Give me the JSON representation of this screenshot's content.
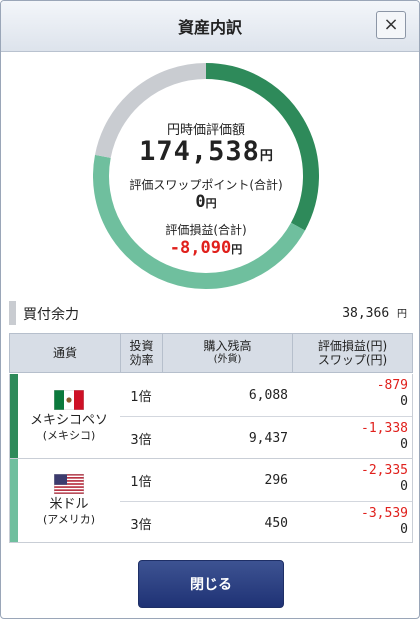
{
  "dialog": {
    "title": "資産内訳",
    "close_icon": "×",
    "close_button_label": "閉じる"
  },
  "summary": {
    "valuation_label": "円時価評価額",
    "valuation_value": "174,538",
    "swap_label": "評価スワップポイント(合計)",
    "swap_value": "0",
    "pl_label": "評価損益(合計)",
    "pl_value": "-8,090",
    "unit": "円"
  },
  "donut": {
    "segments": [
      {
        "name": "メキシコペソ",
        "fraction": 0.33,
        "color": "#2e8a5a"
      },
      {
        "name": "米ドル",
        "fraction": 0.45,
        "color": "#6fbf9e"
      },
      {
        "name": "買付余力",
        "fraction": 0.22,
        "color": "#c9ccd1"
      }
    ]
  },
  "buying_power": {
    "label": "買付余力",
    "value": "38,366",
    "unit": "円"
  },
  "table": {
    "headers": {
      "currency": "通貨",
      "leverage_1": "投資",
      "leverage_2": "効率",
      "balance_1": "購入残高",
      "balance_2": "(外貨)",
      "pl_1": "評価損益(円)",
      "pl_2": "スワップ(円)"
    },
    "groups": [
      {
        "currency": "メキシコペソ",
        "country": "(メキシコ)",
        "flag": "mexico-flag-icon",
        "color": "#2e8a5a",
        "rows": [
          {
            "leverage": "1倍",
            "balance": "6,088",
            "pl": "-879",
            "swap": "0"
          },
          {
            "leverage": "3倍",
            "balance": "9,437",
            "pl": "-1,338",
            "swap": "0"
          }
        ]
      },
      {
        "currency": "米ドル",
        "country": "(アメリカ)",
        "flag": "usa-flag-icon",
        "color": "#6fbf9e",
        "rows": [
          {
            "leverage": "1倍",
            "balance": "296",
            "pl": "-2,335",
            "swap": "0"
          },
          {
            "leverage": "3倍",
            "balance": "450",
            "pl": "-3,539",
            "swap": "0"
          }
        ]
      }
    ]
  }
}
